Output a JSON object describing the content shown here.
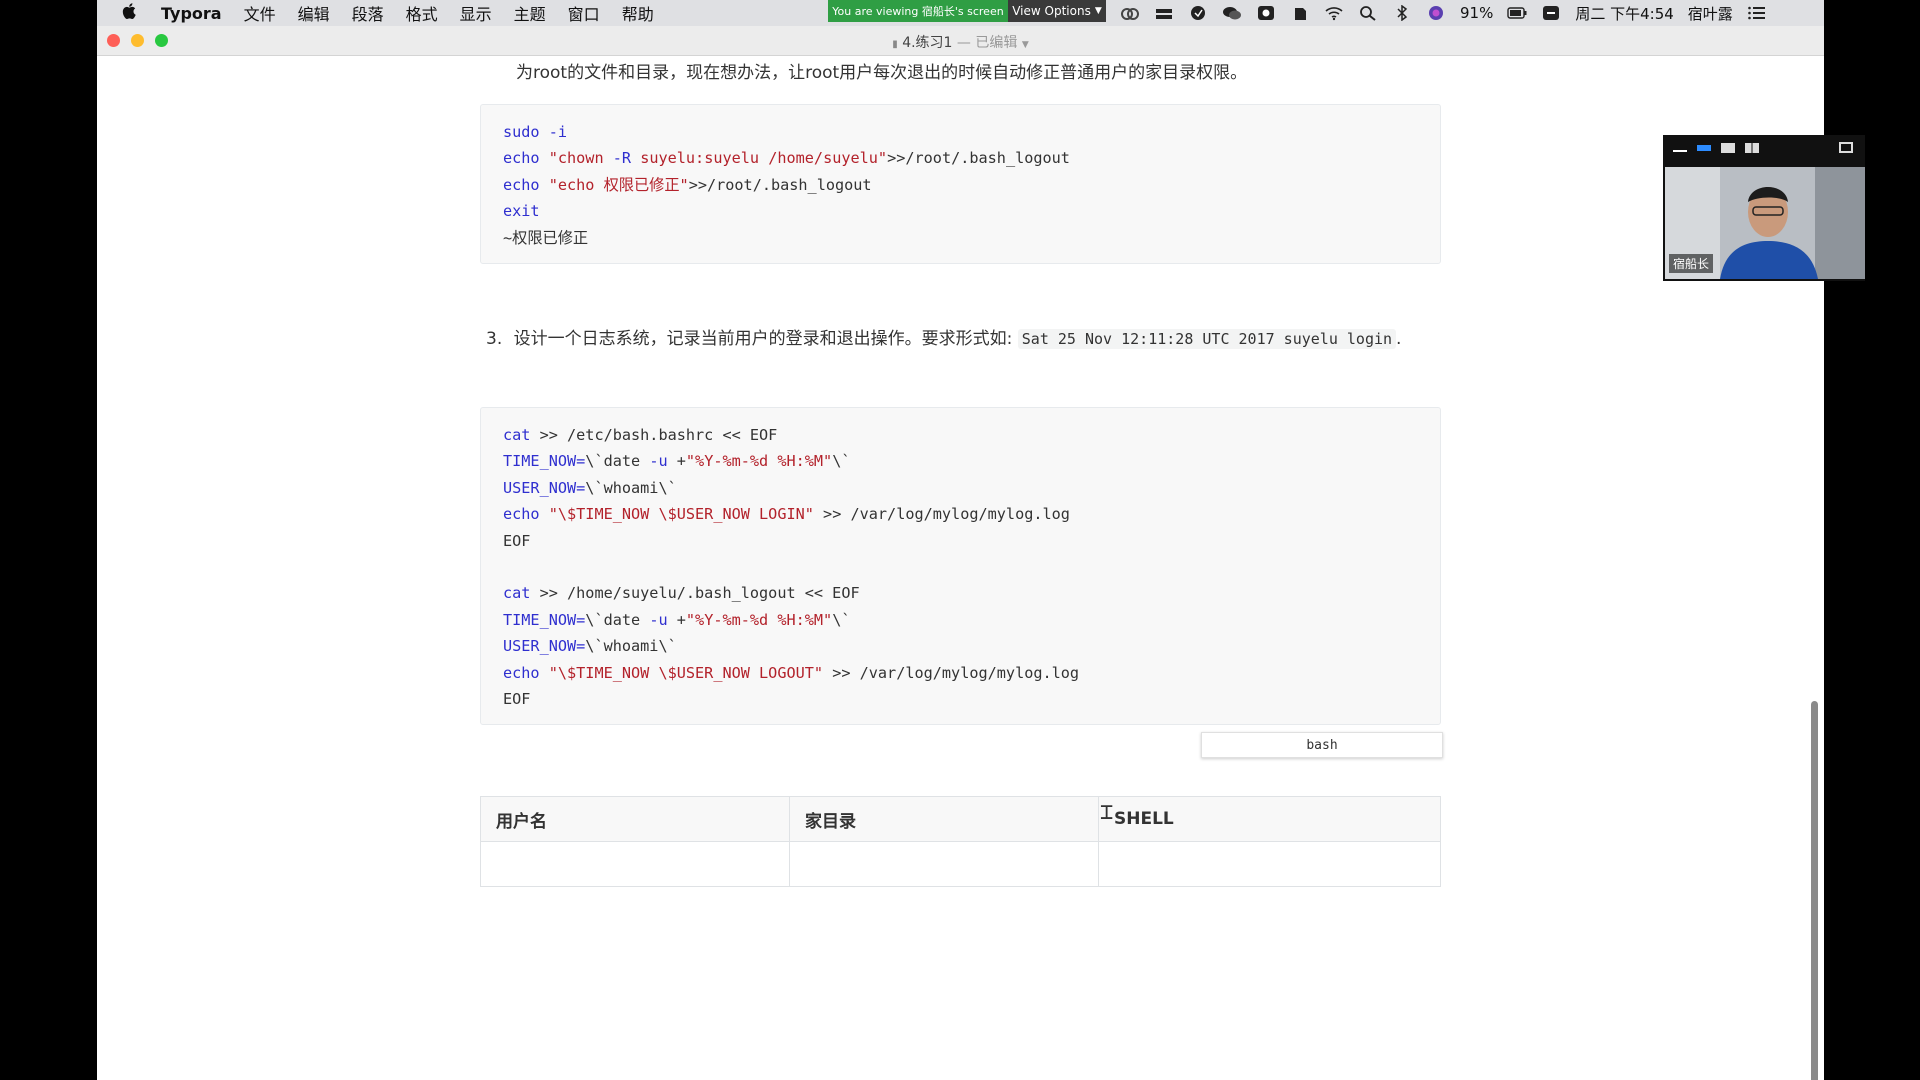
{
  "menubar": {
    "app_name": "Typora",
    "menus": [
      "文件",
      "编辑",
      "段落",
      "格式",
      "显示",
      "主题",
      "窗口",
      "帮助"
    ],
    "share_banner": "You are viewing 宿船长's screen",
    "view_options": "View Options",
    "battery": "91%",
    "clock": "周二 下午4:54",
    "user": "宿叶露"
  },
  "window": {
    "title": "4.练习1",
    "subtitle": "— 已编辑"
  },
  "document": {
    "intro_line": "为root的文件和目录，现在想办法，让root用户每次退出的时候自动修正普通用户的家目录权限。",
    "code_block_1": [
      "sudo -i",
      "echo \"chown -R suyelu:suyelu /home/suyelu\">>/root/.bash_logout",
      "echo \"echo 权限已修正\">>/root/.bash_logout",
      "exit",
      "~权限已修正"
    ],
    "item3": {
      "number": "3.",
      "text": "设计一个日志系统，记录当前用户的登录和退出操作。要求形式如:",
      "inline_code": "Sat 25 Nov 12:11:28 UTC 2017 suyelu login",
      "trail": "."
    },
    "code_block_2": [
      "cat >> /etc/bash.bashrc << EOF",
      "TIME_NOW=\\`date -u +\"%Y-%m-%d %H:%M\"\\`",
      "USER_NOW=\\`whoami\\`",
      "echo \"\\$TIME_NOW \\$USER_NOW LOGIN\" >> /var/log/mylog/mylog.log",
      "EOF",
      "",
      "cat >> /home/suyelu/.bash_logout << EOF",
      "TIME_NOW=\\`date -u +\"%Y-%m-%d %H:%M\"\\`",
      "USER_NOW=\\`whoami\\`",
      "echo \"\\$TIME_NOW \\$USER_NOW LOGOUT\" >> /var/log/mylog/mylog.log",
      "EOF"
    ],
    "code_lang": "bash",
    "table": {
      "headers": [
        "用户名",
        "家目录",
        "SHELL"
      ],
      "rows": [
        [
          "",
          "",
          ""
        ]
      ]
    }
  },
  "video": {
    "participant": "宿船长"
  }
}
